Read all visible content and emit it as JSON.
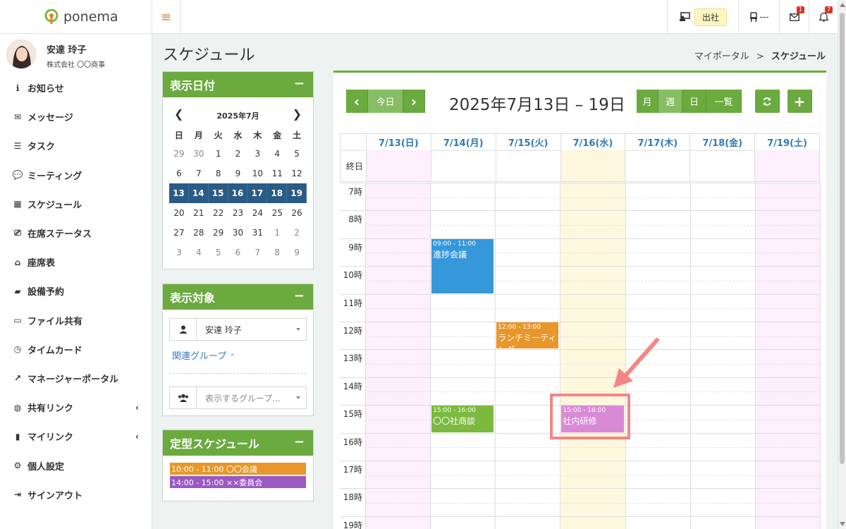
{
  "app": {
    "name": "ponema"
  },
  "header": {
    "attendance_label": "出社",
    "seat_label": "---",
    "mail_badge": "1",
    "bell_badge": "7"
  },
  "user": {
    "name": "安達 玲子",
    "company": "株式会社 〇〇商事"
  },
  "sidebar": {
    "items": [
      {
        "label": "お知らせ",
        "icon": "info-icon"
      },
      {
        "label": "メッセージ",
        "icon": "envelope-icon"
      },
      {
        "label": "タスク",
        "icon": "list-icon"
      },
      {
        "label": "ミーティング",
        "icon": "chat-icon"
      },
      {
        "label": "スケジュール",
        "icon": "calendar-icon"
      },
      {
        "label": "在席ステータス",
        "icon": "presence-icon"
      },
      {
        "label": "座席表",
        "icon": "seat-icon"
      },
      {
        "label": "設備予約",
        "icon": "book-icon"
      },
      {
        "label": "ファイル共有",
        "icon": "folder-icon"
      },
      {
        "label": "タイムカード",
        "icon": "clock-icon"
      },
      {
        "label": "マネージャーポータル",
        "icon": "chart-icon"
      },
      {
        "label": "共有リンク",
        "icon": "globe-icon",
        "chevron": "‹"
      },
      {
        "label": "マイリンク",
        "icon": "bookmark-icon",
        "chevron": "‹"
      },
      {
        "label": "個人設定",
        "icon": "gear-icon"
      },
      {
        "label": "サインアウト",
        "icon": "signout-icon"
      }
    ]
  },
  "page": {
    "title": "スケジュール",
    "breadcrumb_parent": "マイポータル",
    "breadcrumb_sep": ">",
    "breadcrumb_current": "スケジュール"
  },
  "date_panel": {
    "title": "表示日付",
    "collapse": "−",
    "month": "2025年7月",
    "weekdays": [
      "日",
      "月",
      "火",
      "水",
      "木",
      "金",
      "土"
    ],
    "weeks": [
      [
        {
          "d": "29",
          "dim": true
        },
        {
          "d": "30",
          "dim": true
        },
        {
          "d": "1"
        },
        {
          "d": "2"
        },
        {
          "d": "3"
        },
        {
          "d": "4"
        },
        {
          "d": "5"
        }
      ],
      [
        {
          "d": "6"
        },
        {
          "d": "7"
        },
        {
          "d": "8"
        },
        {
          "d": "9"
        },
        {
          "d": "10"
        },
        {
          "d": "11"
        },
        {
          "d": "12"
        }
      ],
      [
        {
          "d": "13",
          "sel": true
        },
        {
          "d": "14",
          "sel": true
        },
        {
          "d": "15",
          "sel": true
        },
        {
          "d": "16",
          "sel": true
        },
        {
          "d": "17",
          "sel": true
        },
        {
          "d": "18",
          "sel": true
        },
        {
          "d": "19",
          "sel": true
        }
      ],
      [
        {
          "d": "20"
        },
        {
          "d": "21"
        },
        {
          "d": "22"
        },
        {
          "d": "23"
        },
        {
          "d": "24"
        },
        {
          "d": "25"
        },
        {
          "d": "26"
        }
      ],
      [
        {
          "d": "27"
        },
        {
          "d": "28"
        },
        {
          "d": "29"
        },
        {
          "d": "30"
        },
        {
          "d": "31"
        },
        {
          "d": "1",
          "dim": true
        },
        {
          "d": "2",
          "dim": true
        }
      ],
      [
        {
          "d": "3",
          "dim": true
        },
        {
          "d": "4",
          "dim": true
        },
        {
          "d": "5",
          "dim": true
        },
        {
          "d": "6",
          "dim": true
        },
        {
          "d": "7",
          "dim": true
        },
        {
          "d": "8",
          "dim": true
        },
        {
          "d": "9",
          "dim": true
        }
      ]
    ]
  },
  "target_panel": {
    "title": "表示対象",
    "collapse": "−",
    "user_value": "安達 玲子",
    "group_link": "関連グループ",
    "group_placeholder": "表示するグループ..."
  },
  "routine_panel": {
    "title": "定型スケジュール",
    "collapse": "−",
    "items": [
      {
        "label": "10:00 - 11:00 〇〇会議",
        "color": "#e8972a"
      },
      {
        "label": "14:00 - 15:00 ××委員会",
        "color": "#9b59c0"
      }
    ]
  },
  "toolbar": {
    "prev": "‹",
    "today": "今日",
    "next": "›",
    "range_title": "2025年7月13日 – 19日",
    "views": [
      "月",
      "週",
      "日",
      "一覧"
    ],
    "active_view": "週",
    "refresh": "refresh-icon",
    "add": "+"
  },
  "calendar": {
    "days": [
      "7/13(日)",
      "7/14(月)",
      "7/15(火)",
      "7/16(水)",
      "7/17(木)",
      "7/18(金)",
      "7/19(土)"
    ],
    "allday_label": "終日",
    "hours": [
      "7時",
      "8時",
      "9時",
      "10時",
      "11時",
      "12時",
      "13時",
      "14時",
      "15時",
      "16時",
      "17時",
      "18時",
      "19時"
    ],
    "first_hour": 7,
    "colors": {
      "weekend": "#fdeffc",
      "today": "#fdf7dd",
      "accent": "#6aaa3f"
    },
    "events": [
      {
        "day": 1,
        "start": 9,
        "end": 11,
        "time": "09:00 - 11:00",
        "title": "進捗会議",
        "color": "#3498db"
      },
      {
        "day": 2,
        "start": 12,
        "end": 13,
        "time": "12:00 - 13:00",
        "title": "ランチミーティング",
        "color": "#e8972a"
      },
      {
        "day": 1,
        "start": 15,
        "end": 16,
        "time": "15:00 - 16:00",
        "title": "〇〇社商談",
        "color": "#7cb93f"
      },
      {
        "day": 3,
        "start": 15,
        "end": 16,
        "time": "15:00 - 16:00",
        "title": "社内研修",
        "color": "#d98ad6"
      }
    ]
  }
}
